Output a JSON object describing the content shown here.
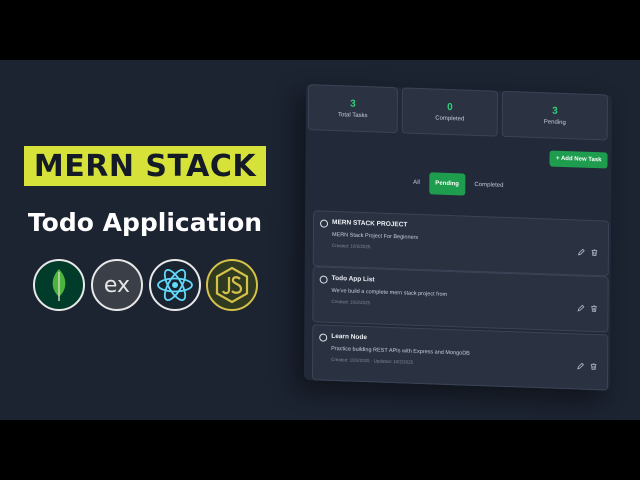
{
  "promo": {
    "headline": "MERN STACK",
    "subhead": "Todo Application",
    "logos": [
      {
        "icon": "mongodb-leaf-icon",
        "color": "#4db33d"
      },
      {
        "icon": "express-icon",
        "text": "ex"
      },
      {
        "icon": "react-atom-icon",
        "color": "#61dafb"
      },
      {
        "icon": "nodejs-hexagon-icon",
        "color": "#d6c24a"
      }
    ]
  },
  "stats": [
    {
      "value": "3",
      "label": "Total Tasks"
    },
    {
      "value": "0",
      "label": "Completed"
    },
    {
      "value": "3",
      "label": "Pending"
    }
  ],
  "toolbar": {
    "add_label": "+ Add New Task"
  },
  "filters": {
    "items": [
      "All",
      "Pending",
      "Completed"
    ],
    "active": "Pending"
  },
  "tasks": [
    {
      "title": "MERN STACK PROJECT",
      "description": "MERN Stack Project For Beginners",
      "meta": "Created: 10/2/2025"
    },
    {
      "title": "Todo App List",
      "description": "We've build a complete mern stack project from",
      "meta": "Created: 10/2/2025"
    },
    {
      "title": "Learn Node",
      "description": "Practice building REST APIs with Express and MongoDB",
      "meta": "Created: 10/2/2025 · Updated: 10/2/2025"
    }
  ],
  "colors": {
    "background": "#1c2331",
    "accent": "#1f9d4f",
    "stat_value": "#2fd07a",
    "headline_bg": "#d6e13a"
  }
}
